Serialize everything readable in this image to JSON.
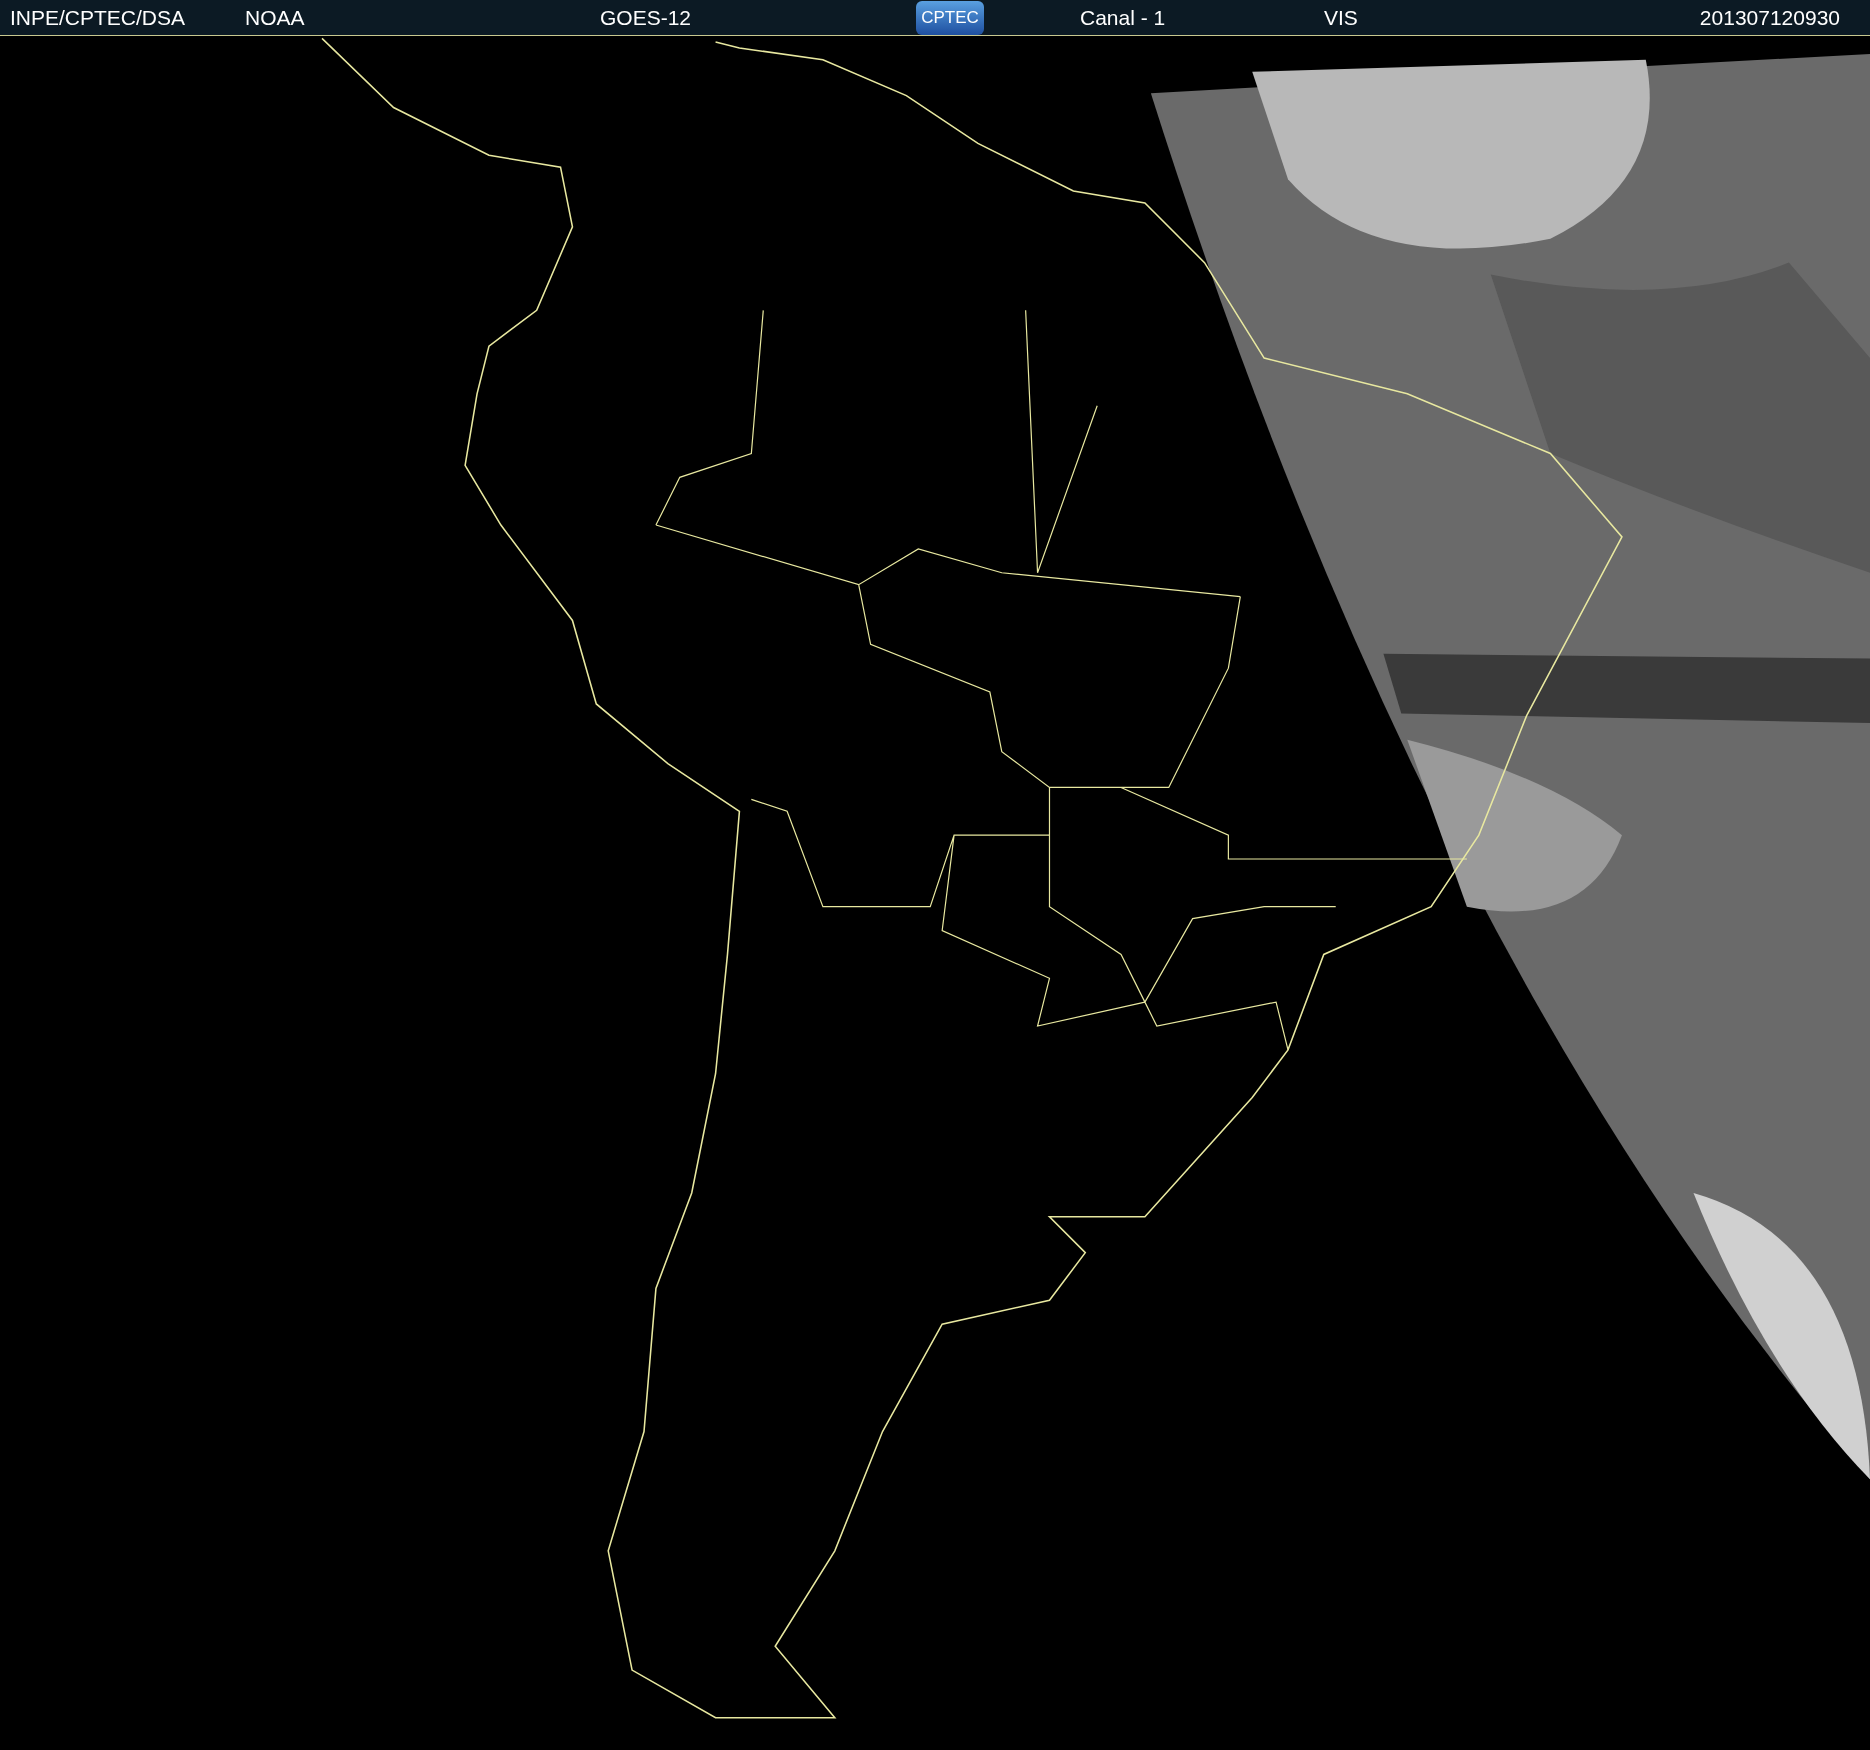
{
  "header": {
    "source": "INPE/CPTEC/DSA",
    "agency": "NOAA",
    "satellite": "GOES-12",
    "logo": "CPTEC",
    "channel": "Canal - 1",
    "band": "VIS",
    "timestamp": "201307120930"
  }
}
